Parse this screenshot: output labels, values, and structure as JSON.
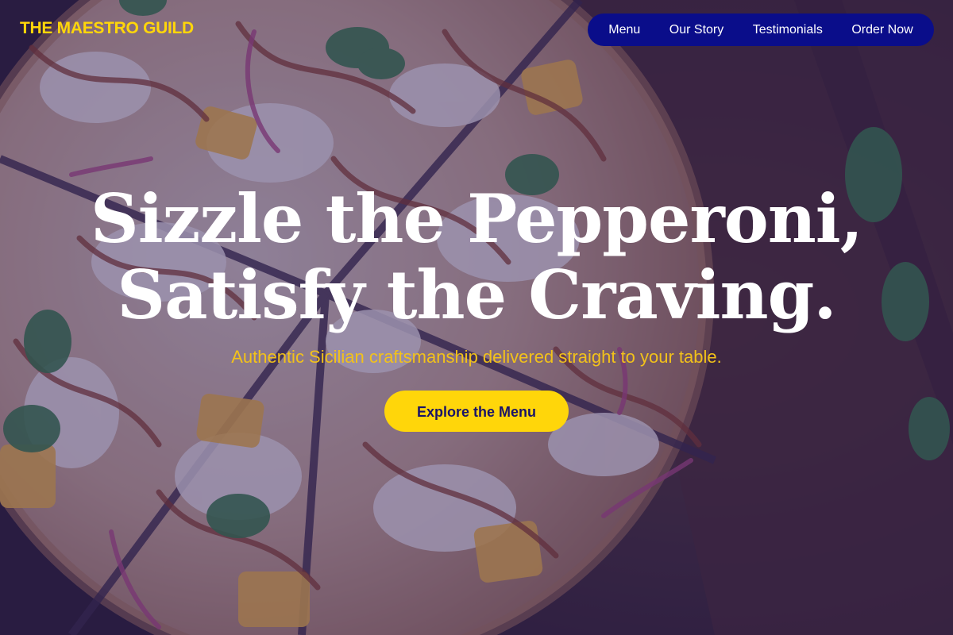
{
  "brand": {
    "logo_text": "THE MAESTRO GUILD"
  },
  "nav": {
    "items": [
      {
        "label": "Menu"
      },
      {
        "label": "Our Story"
      },
      {
        "label": "Testimonials"
      },
      {
        "label": "Order Now"
      }
    ]
  },
  "hero": {
    "title_line_1": "Sizzle the Pepperoni,",
    "title_line_2": "Satisfy the Craving.",
    "subtitle": "Authentic Sicilian craftsmanship delivered straight to your table.",
    "cta_label": "Explore the Menu",
    "background_image": "pizza-photo"
  },
  "colors": {
    "accent_yellow": "#ffd60a",
    "subtitle_gold": "#f2c21a",
    "nav_background": "#0a0d8a",
    "overlay_tint": "#281e6e",
    "title_white": "#ffffff",
    "cta_text": "#1a1468"
  }
}
